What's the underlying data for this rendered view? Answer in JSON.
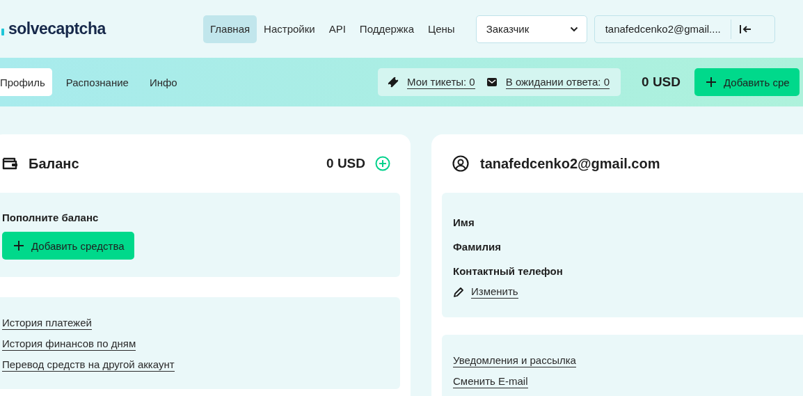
{
  "header": {
    "logo": "solvecaptcha",
    "nav": [
      {
        "label": "Главная",
        "selected": true
      },
      {
        "label": "Настройки",
        "selected": false
      },
      {
        "label": "API",
        "selected": false
      },
      {
        "label": "Поддержка",
        "selected": false
      },
      {
        "label": "Цены",
        "selected": false
      }
    ],
    "role_select": {
      "value": "Заказчик"
    },
    "account": {
      "email": "tanafedcenko2@gmail...."
    }
  },
  "subnav": {
    "tabs": [
      {
        "label": "Профиль",
        "selected": true
      },
      {
        "label": "Распознание",
        "selected": false
      },
      {
        "label": "Инфо",
        "selected": false
      }
    ],
    "tickets": [
      {
        "kind": "ticket",
        "label": "Мои тикеты: 0"
      },
      {
        "kind": "mail",
        "label": "В ожидании ответа: 0"
      }
    ],
    "balance": "0 USD",
    "add_button": "Добавить сре"
  },
  "balance_card": {
    "title": "Баланс",
    "amount": "0 USD",
    "topup": {
      "title": "Пополните баланс",
      "button": "Добавить средства"
    },
    "links": [
      "История платежей",
      "История финансов по дням",
      "Перевод средств на другой аккаунт"
    ]
  },
  "profile_card": {
    "email": "tanafedcenko2@gmail.com",
    "fields": [
      "Имя",
      "Фамилия",
      "Контактный телефон"
    ],
    "edit_link": "Изменить",
    "links": [
      "Уведомления и рассылка",
      "Сменить E-mail"
    ]
  }
}
